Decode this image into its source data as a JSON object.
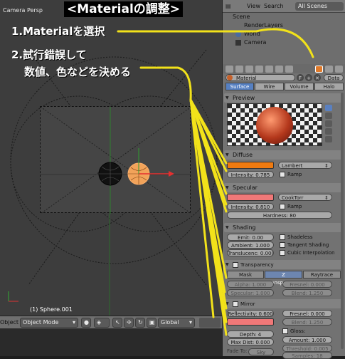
{
  "annotation": {
    "title": "<Materialの調整>",
    "step1": "1.Materialを選択",
    "step2_line1": "2.試行錯誤して",
    "step2_line2": "数値、色などを決める"
  },
  "viewport": {
    "label": "Camera Persp",
    "object_label": "(1) Sphere.001",
    "header": {
      "object_label": "Object",
      "mode": "Object Mode",
      "orientation": "Global"
    }
  },
  "outliner": {
    "tabs": [
      "View",
      "Search",
      "All Scenes"
    ],
    "items": [
      "Scene",
      "RenderLayers",
      "World",
      "Camera"
    ]
  },
  "properties": {
    "material_name": "Material",
    "data_label": "Data",
    "type_tabs": [
      "Surface",
      "Wire",
      "Volume",
      "Halo"
    ],
    "active_type_tab": "Surface",
    "preview": {
      "title": "Preview"
    },
    "diffuse": {
      "title": "Diffuse",
      "color": "#ee7a10",
      "shader": "Lambert",
      "intensity": "Intensity: 0.785",
      "ramp": "Ramp"
    },
    "specular": {
      "title": "Specular",
      "color": "#f07878",
      "shader": "CookTorr",
      "intensity": "Intensity: 0.810",
      "ramp": "Ramp",
      "hardness": "Hardness: 80"
    },
    "shading": {
      "title": "Shading",
      "emit": "Emit: 0.00",
      "ambient": "Ambient: 1.000",
      "translucency": "Translucenc: 0.000",
      "shadeless": "Shadeless",
      "tangent_shading": "Tangent Shading",
      "cubic_interpolation": "Cubic Interpolation"
    },
    "transparency": {
      "title": "Transparency",
      "modes": [
        "Mask",
        "Z Transparency",
        "Raytrace"
      ],
      "active_mode": "Z Transparency",
      "alpha": "Alpha: 1.000",
      "fresnel": "Fresnel: 0.000",
      "specular": "Specular: 1.000",
      "blend": "Blend: 1.250"
    },
    "mirror": {
      "title": "Mirror",
      "reflectivity": "Reflectivity: 0.600",
      "fresnel": "Fresnel: 0.000",
      "blend": "Blend: 1.250",
      "color": "#f07878",
      "depth": "Depth: 4",
      "max_dist": "Max Dist: 0.000",
      "gloss_label": "Gloss:",
      "amount": "Amount: 1.000",
      "threshold": "Threshold: 0.005",
      "fade_to": "Fade To:",
      "sky": "Sky",
      "samples": "Samples: 18"
    }
  },
  "colors": {
    "annotation_line": "#f2e21a"
  }
}
